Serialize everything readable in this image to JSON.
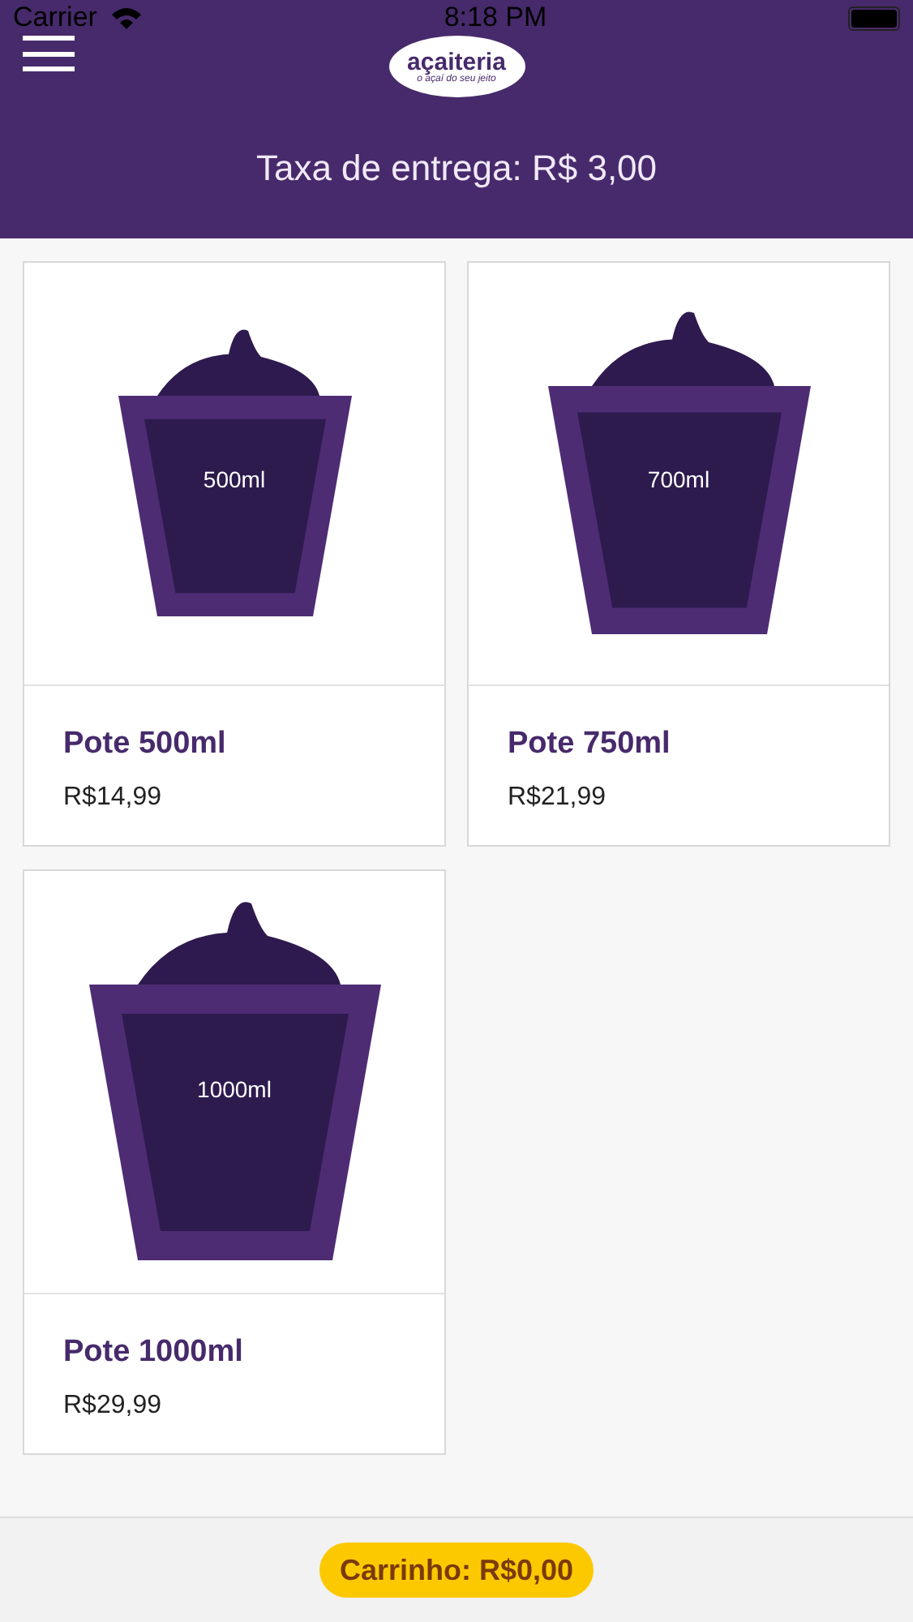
{
  "status_bar": {
    "carrier": "Carrier",
    "time": "8:18 PM"
  },
  "header": {
    "logo": {
      "name": "açaiteria",
      "tagline": "o açaí do seu jeito"
    },
    "delivery_fee": "Taxa de entrega: R$ 3,00"
  },
  "products": [
    {
      "name": "Pote 500ml",
      "price": "R$14,99",
      "volume_label": "500ml",
      "kind": "small"
    },
    {
      "name": "Pote 750ml",
      "price": "R$21,99",
      "volume_label": "700ml",
      "kind": "medium"
    },
    {
      "name": "Pote 1000ml",
      "price": "R$29,99",
      "volume_label": "1000ml",
      "kind": "large"
    }
  ],
  "cart": {
    "label": "Carrinho: R$0,00"
  }
}
